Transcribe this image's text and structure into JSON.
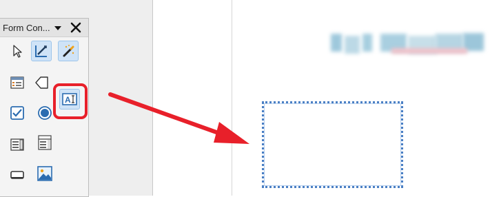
{
  "toolbar": {
    "title": "Form Con...",
    "menu_icon": "dropdown-triangle-icon",
    "close_icon": "close-icon",
    "tools": [
      {
        "name": "select-tool",
        "icon": "pointer-arrow-icon",
        "active": false
      },
      {
        "name": "design-mode-tool",
        "icon": "design-mode-icon",
        "active": true
      },
      {
        "name": "control-wizards-tool",
        "icon": "wand-icon",
        "active": true
      },
      {
        "name": "form-properties-tool",
        "icon": "form-properties-icon",
        "active": false
      },
      {
        "name": "label-tool",
        "icon": "tag-icon",
        "active": false
      },
      {
        "name": "text-box-tool",
        "icon": "text-box-icon",
        "active": true
      },
      {
        "name": "check-box-tool",
        "icon": "checkbox-icon",
        "active": false
      },
      {
        "name": "option-button-tool",
        "icon": "radio-icon",
        "active": false
      },
      {
        "name": "list-box-tool",
        "icon": "list-box-icon",
        "active": false
      },
      {
        "name": "combo-box-tool",
        "icon": "combo-box-icon",
        "active": false
      },
      {
        "name": "push-button-tool",
        "icon": "push-button-icon",
        "active": false
      },
      {
        "name": "image-button-tool",
        "icon": "image-icon",
        "active": false
      }
    ]
  },
  "annotation": {
    "highlight_color": "#e8202a",
    "arrow_color": "#e8202a"
  },
  "document": {
    "heading_obscured": true,
    "text_box_border_color": "#4a7fc4"
  }
}
